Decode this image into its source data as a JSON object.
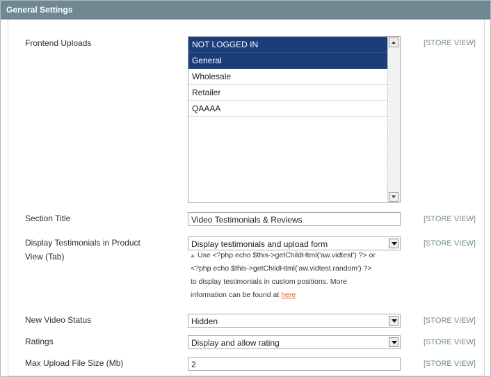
{
  "section": {
    "title": "General Settings"
  },
  "scope_label": "[STORE VIEW]",
  "fields": {
    "frontend_uploads": {
      "label": "Frontend Uploads",
      "options": [
        "NOT LOGGED IN",
        "General",
        "Wholesale",
        "Retailer",
        "QAAAA"
      ],
      "selected": [
        "NOT LOGGED IN",
        "General"
      ]
    },
    "section_title": {
      "label": "Section Title",
      "value": "Video Testimonials & Reviews"
    },
    "display_testimonials": {
      "label_line1": "Display Testimonials in Product",
      "label_line2": "View (Tab)",
      "value": "Display testimonials and upload form",
      "note": {
        "line1": "Use <?php echo $this->getChildHtml('aw.vidtest') ?> or",
        "line2": "<?php echo $this->getChildHtml('aw.vidtest.random') ?>",
        "line3": "to display testimonials in custom positions. More",
        "line4": "information can be found at",
        "link": "here"
      }
    },
    "new_video_status": {
      "label": "New Video Status",
      "value": "Hidden"
    },
    "ratings": {
      "label": "Ratings",
      "value": "Display and allow rating"
    },
    "max_upload": {
      "label": "Max Upload File Size (Mb)",
      "value": "2"
    }
  },
  "icons": {
    "scroll_up": "triangle-up-icon",
    "scroll_down": "triangle-down-icon",
    "dropdown": "chevron-down-icon",
    "note": "triangle-note-icon"
  }
}
